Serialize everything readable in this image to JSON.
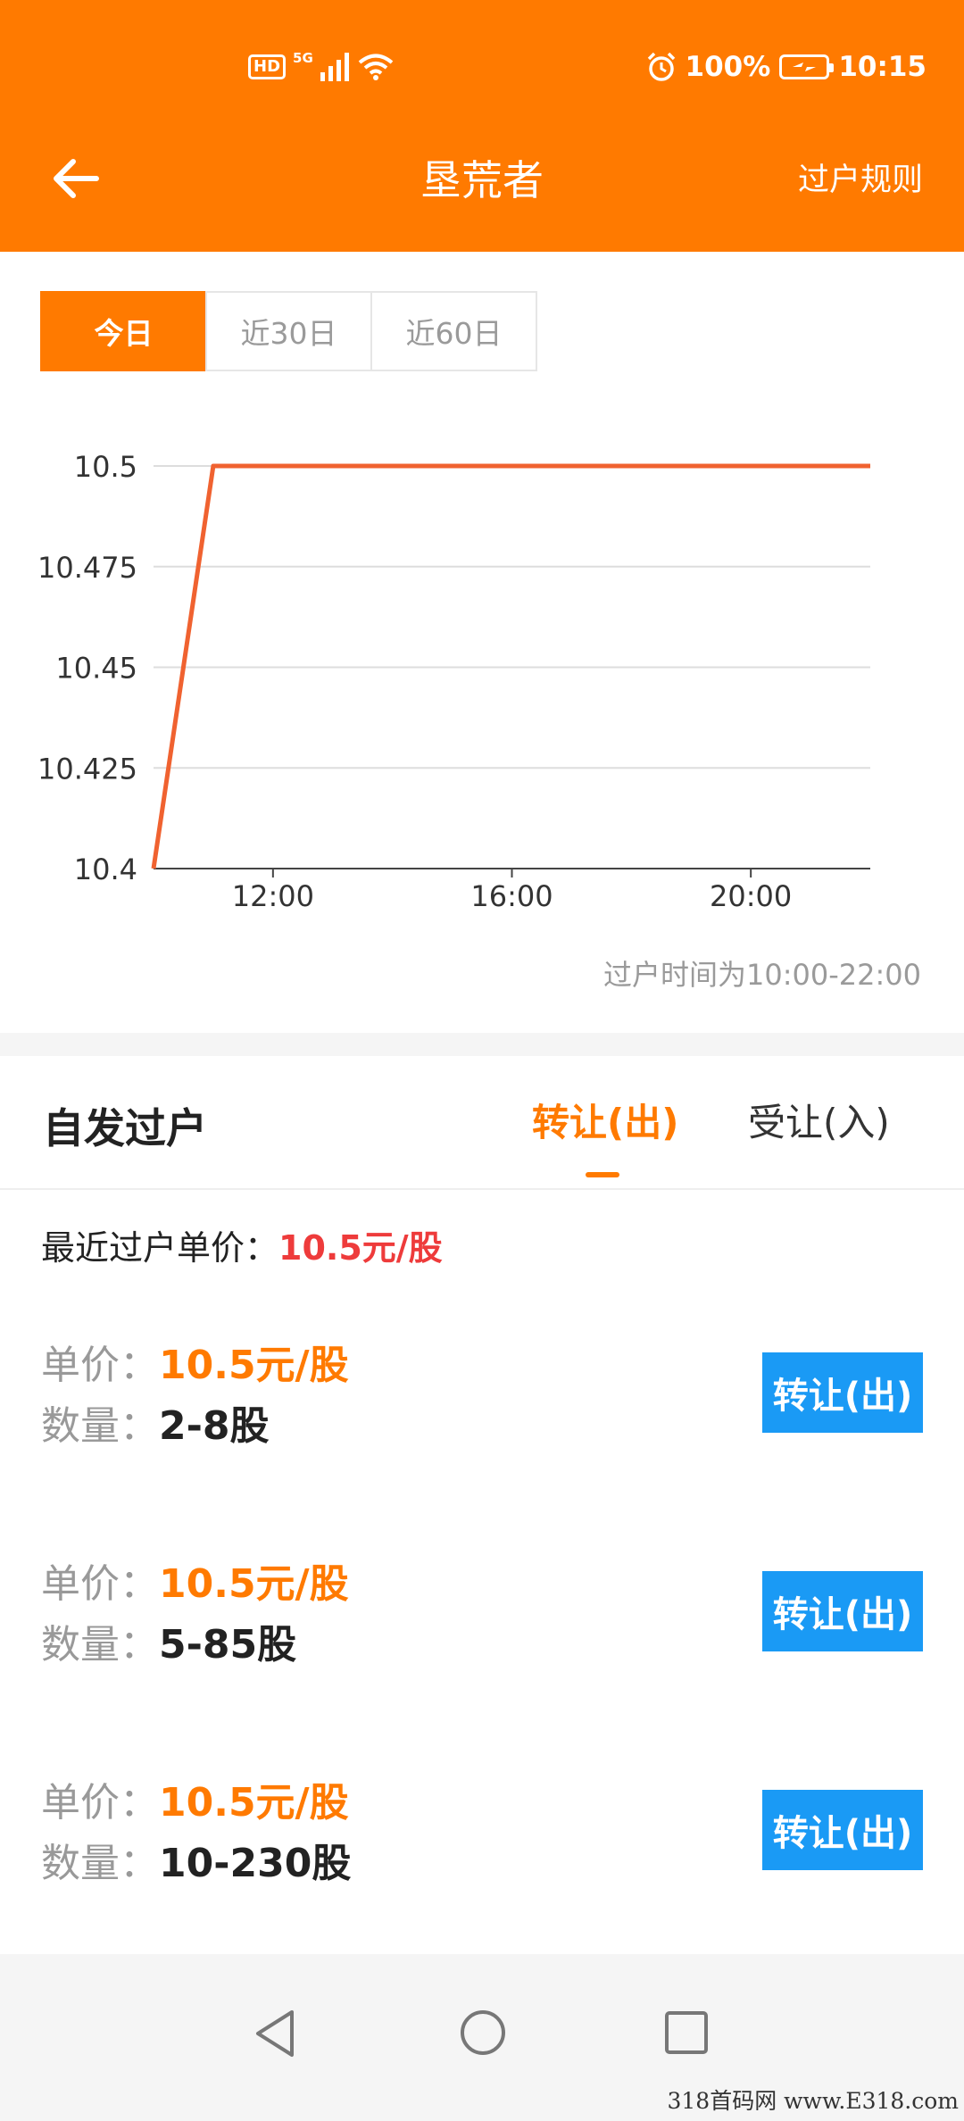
{
  "status_bar": {
    "hd": "HD",
    "network": "5G",
    "battery": "100%",
    "time": "10:15"
  },
  "nav": {
    "title": "垦荒者",
    "rules_link": "过户规则"
  },
  "period_tabs": [
    {
      "label": "今日",
      "active": true
    },
    {
      "label": "近30日",
      "active": false
    },
    {
      "label": "近60日",
      "active": false
    }
  ],
  "chart_data": {
    "type": "line",
    "x_label": "",
    "y_label": "",
    "x_ticks": [
      "12:00",
      "16:00",
      "20:00"
    ],
    "y_ticks": [
      "10.5",
      "10.475",
      "10.45",
      "10.425",
      "10.4"
    ],
    "ylim": [
      10.4,
      10.5
    ],
    "xlim": [
      "10:00",
      "22:00"
    ],
    "grid": "horizontal",
    "series": [
      {
        "color": "#f06230",
        "points": [
          {
            "x": "10:00",
            "y": 10.4
          },
          {
            "x": "11:00",
            "y": 10.5
          },
          {
            "x": "22:00",
            "y": 10.5
          }
        ]
      }
    ]
  },
  "chart_note": "过户时间为10:00-22:00",
  "trade": {
    "title": "自发过户",
    "tab_out": "转让(出)",
    "tab_in": "受让(入)",
    "recent_label": "最近过户单价：",
    "recent_price": "10.5元/股",
    "price_label": "单价：",
    "qty_label": "数量：",
    "button_label": "转让(出)",
    "listings": [
      {
        "price": "10.5元/股",
        "qty": "2-8股"
      },
      {
        "price": "10.5元/股",
        "qty": "5-85股"
      },
      {
        "price": "10.5元/股",
        "qty": "10-230股"
      }
    ]
  },
  "colors": {
    "brand": "#ff7a00",
    "button": "#1a9af5",
    "recent_price": "#ee3b3b"
  },
  "watermark": "318首码网 www.E318.com"
}
